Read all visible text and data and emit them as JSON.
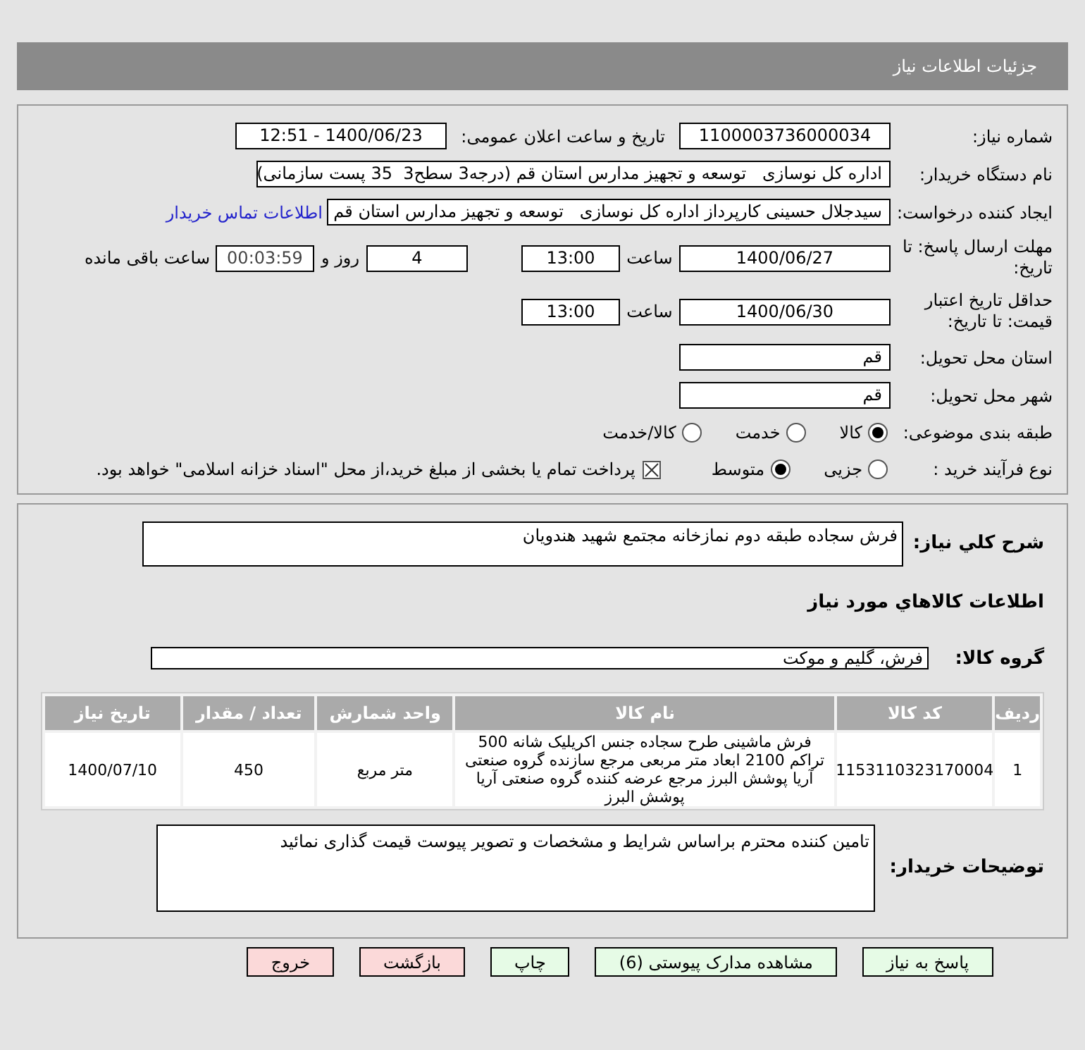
{
  "header": {
    "title": "جزئیات اطلاعات نیاز"
  },
  "need_number": {
    "label": "شماره نیاز:",
    "value": "1100003736000034"
  },
  "announce": {
    "label": "تاریخ و ساعت اعلان عمومی:",
    "value": "1400/06/23 - 12:51"
  },
  "buyer_org": {
    "label": "نام دستگاه خریدار:",
    "value": "اداره کل نوسازی   توسعه و تجهیز مدارس استان قم (درجه3 سطح3  35 پست سازمانی)"
  },
  "requester": {
    "label": "ایجاد کننده درخواست:",
    "value": "سیدجلال حسینی کارپرداز اداره کل نوسازی   توسعه و تجهیز مدارس استان قم",
    "link": "اطلاعات تماس خریدار"
  },
  "reply_deadline": {
    "label": "مهلت ارسال پاسخ: تا تاریخ:",
    "date": "1400/06/27",
    "time_label": "ساعت",
    "time": "13:00",
    "days": "4",
    "days_label": "روز و",
    "remaining": "00:03:59",
    "remaining_label": "ساعت باقی مانده"
  },
  "price_validity": {
    "label": "حداقل تاریخ اعتبار قیمت: تا تاریخ:",
    "date": "1400/06/30",
    "time_label": "ساعت",
    "time": "13:00"
  },
  "province": {
    "label": "استان محل تحویل:",
    "value": "قم"
  },
  "city": {
    "label": "شهر محل تحویل:",
    "value": "قم"
  },
  "category": {
    "label": "طبقه بندی موضوعی:",
    "options": [
      {
        "label": "کالا",
        "selected": true
      },
      {
        "label": "خدمت",
        "selected": false
      },
      {
        "label": "کالا/خدمت",
        "selected": false
      }
    ]
  },
  "process": {
    "label": "نوع فرآیند خرید :",
    "options": [
      {
        "label": "جزیی",
        "selected": false
      },
      {
        "label": "متوسط",
        "selected": true
      }
    ],
    "payment": {
      "checked": true,
      "text": "پرداخت تمام یا بخشی از مبلغ خرید،از محل \"اسناد خزانه اسلامی\" خواهد بود."
    }
  },
  "description": {
    "label": "شرح كلي نياز:",
    "value": "فرش سجاده طبقه دوم نمازخانه مجتمع شهید هندویان"
  },
  "goods_title": "اطلاعات كالاهاي مورد نياز",
  "goods_group": {
    "label": "گروه کالا:",
    "value": "فرش، گلیم و موکت"
  },
  "table": {
    "columns": [
      "ردیف",
      "کد کالا",
      "نام کالا",
      "واحد شمارش",
      "تعداد / مقدار",
      "تاریخ نیاز"
    ],
    "rows": [
      [
        "1",
        "1153110323170004",
        "فرش ماشینی طرح سجاده جنس اکریلیک شانه 500 تراکم 2100 ابعاد متر مربعی مرجع سازنده گروه صنعتی آریا پوشش البرز مرجع عرضه کننده گروه صنعتی آریا پوشش البرز",
        "متر مربع",
        "450",
        "1400/07/10"
      ]
    ]
  },
  "buyer_notes": {
    "label": "توضیحات خریدار:",
    "value": "تامین کننده محترم براساس شرایط و مشخصات و تصویر پیوست قیمت گذاری نمائید"
  },
  "buttons": [
    {
      "label": "پاسخ به نیاز",
      "kind": "primary"
    },
    {
      "label": "مشاهده مدارک پیوستی (6)",
      "kind": "primary"
    },
    {
      "label": "چاپ",
      "kind": "primary"
    },
    {
      "label": "بازگشت",
      "kind": "danger"
    },
    {
      "label": "خروج",
      "kind": "danger"
    }
  ]
}
